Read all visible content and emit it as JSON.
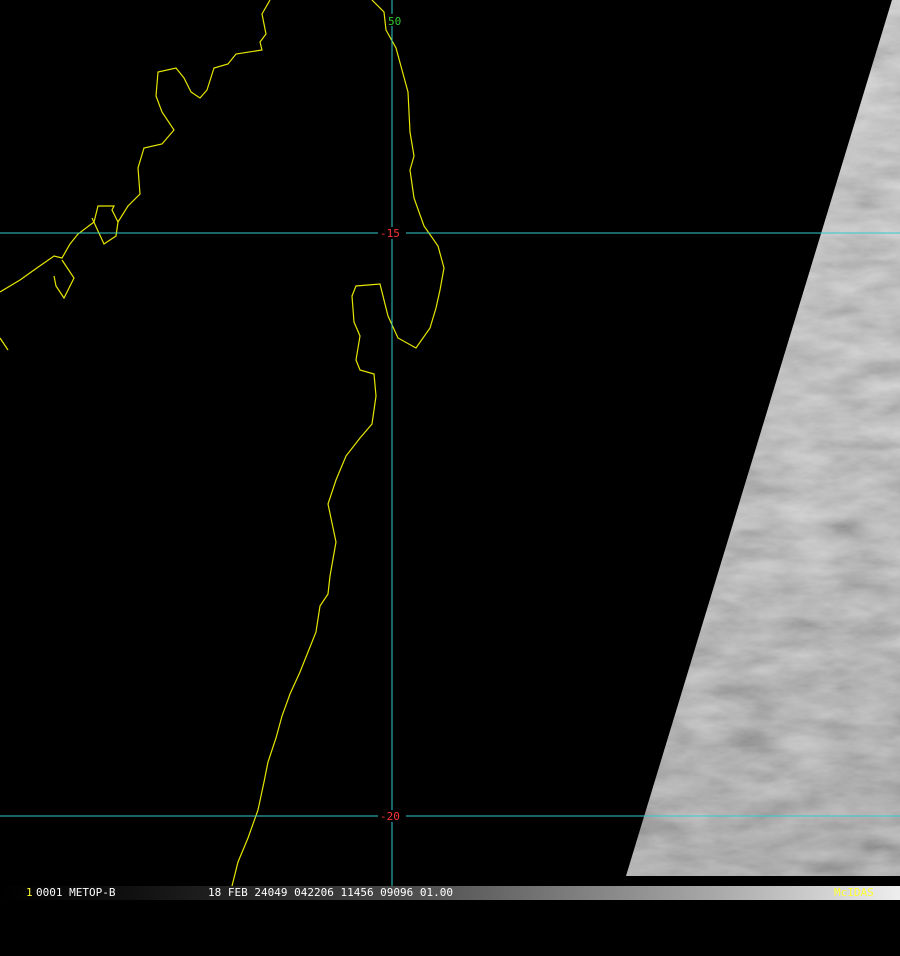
{
  "image": {
    "satellite_label": "0001 METOP-B",
    "frame_marker": "1",
    "timestamp_line": "18 FEB 24049 042206 11456 09096 01.00",
    "software_label": "McIDAS"
  },
  "grid": {
    "latitudes": [
      {
        "label": "-15"
      },
      {
        "label": "-20"
      }
    ],
    "longitudes": [
      {
        "label": "50"
      }
    ]
  },
  "colors": {
    "background": "#000000",
    "grid": "#33cccc",
    "coastline": "#e6e600",
    "lat_label": "#ff3333",
    "lon_label": "#33cc33",
    "status_text": "#ffffff",
    "logo_text": "#ffff33"
  }
}
